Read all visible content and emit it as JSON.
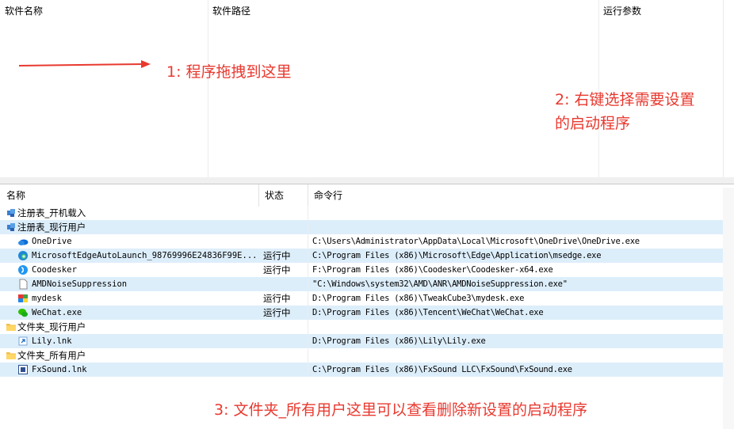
{
  "top_table": {
    "columns": [
      "软件名称",
      "软件路径",
      "运行参数"
    ]
  },
  "annotations": {
    "step1": "1: 程序拖拽到这里",
    "step2_line1": "2: 右键选择需要设置",
    "step2_line2": "的启动程序",
    "step3": "3: 文件夹_所有用户这里可以查看删除新设置的启动程序"
  },
  "startup_tree": {
    "columns": [
      "名称",
      "状态",
      "命令行"
    ],
    "rows": [
      {
        "name": "注册表_开机载入",
        "status": "",
        "command": "",
        "icon": "registry-icon"
      },
      {
        "name": "注册表_现行用户",
        "status": "",
        "command": "",
        "icon": "registry-icon"
      },
      {
        "name": "OneDrive",
        "status": "",
        "command": "C:\\Users\\Administrator\\AppData\\Local\\Microsoft\\OneDrive\\OneDrive.exe",
        "icon": "onedrive-icon"
      },
      {
        "name": "MicrosoftEdgeAutoLaunch_98769996E24836F99E...",
        "status": "运行中",
        "command": "C:\\Program Files (x86)\\Microsoft\\Edge\\Application\\msedge.exe",
        "icon": "edge-icon"
      },
      {
        "name": "Coodesker",
        "status": "运行中",
        "command": "F:\\Program Files (x86)\\Coodesker\\Coodesker-x64.exe",
        "icon": "coodesker-icon"
      },
      {
        "name": "AMDNoiseSuppression",
        "status": "",
        "command": "\"C:\\Windows\\system32\\AMD\\ANR\\AMDNoiseSuppression.exe\"",
        "icon": "blank-file-icon"
      },
      {
        "name": "mydesk",
        "status": "运行中",
        "command": "D:\\Program Files (x86)\\TweakCube3\\mydesk.exe",
        "icon": "mydesk-icon"
      },
      {
        "name": "WeChat.exe",
        "status": "运行中",
        "command": "D:\\Program Files (x86)\\Tencent\\WeChat\\WeChat.exe",
        "icon": "wechat-icon"
      },
      {
        "name": "文件夹_现行用户",
        "status": "",
        "command": "",
        "icon": "folder-icon"
      },
      {
        "name": "Lily.lnk",
        "status": "",
        "command": "D:\\Program Files (x86)\\Lily\\Lily.exe",
        "icon": "shortcut-icon"
      },
      {
        "name": "文件夹_所有用户",
        "status": "",
        "command": "",
        "icon": "folder-icon"
      },
      {
        "name": "FxSound.lnk",
        "status": "",
        "command": "C:\\Program Files (x86)\\FxSound LLC\\FxSound\\FxSound.exe",
        "icon": "fxsound-icon"
      }
    ]
  },
  "colors": {
    "annotation_red": "#e8392f",
    "selection_blue": "#ddeefb"
  }
}
